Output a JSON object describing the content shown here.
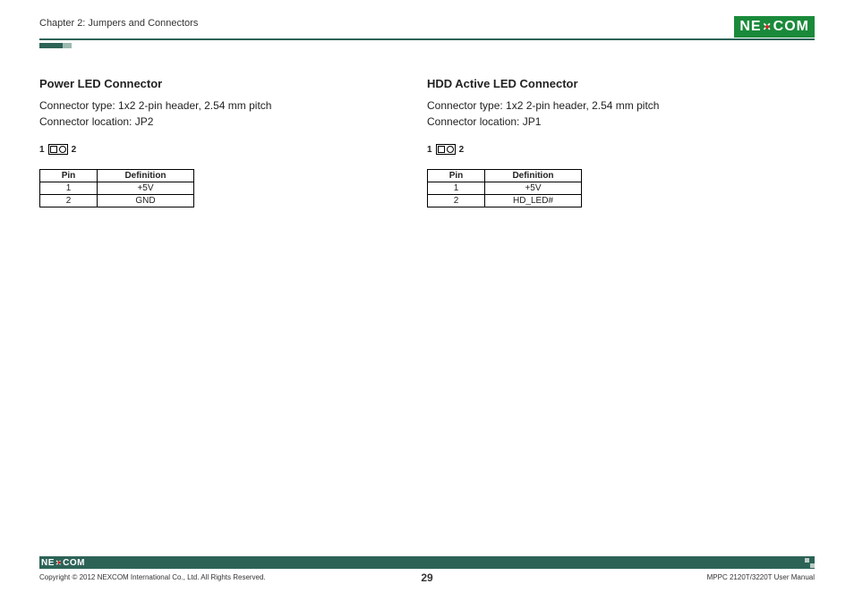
{
  "header": {
    "chapter": "Chapter 2: Jumpers and Connectors",
    "brand": "NEXCOM"
  },
  "left": {
    "title": "Power LED Connector",
    "line1": "Connector type: 1x2 2-pin header, 2.54 mm pitch",
    "line2": "Connector location: JP2",
    "connLabelA": "1",
    "connLabelB": "2",
    "th1": "Pin",
    "th2": "Definition",
    "r1c1": "1",
    "r1c2": "+5V",
    "r2c1": "2",
    "r2c2": "GND"
  },
  "right": {
    "title": "HDD Active LED Connector",
    "line1": "Connector type: 1x2 2-pin header, 2.54 mm pitch",
    "line2": "Connector location: JP1",
    "connLabelA": "1",
    "connLabelB": "2",
    "th1": "Pin",
    "th2": "Definition",
    "r1c1": "1",
    "r1c2": "+5V",
    "r2c1": "2",
    "r2c2": "HD_LED#"
  },
  "footer": {
    "copyright": "Copyright © 2012 NEXCOM International Co., Ltd. All Rights Reserved.",
    "page": "29",
    "manual": "MPPC 2120T/3220T User Manual"
  }
}
